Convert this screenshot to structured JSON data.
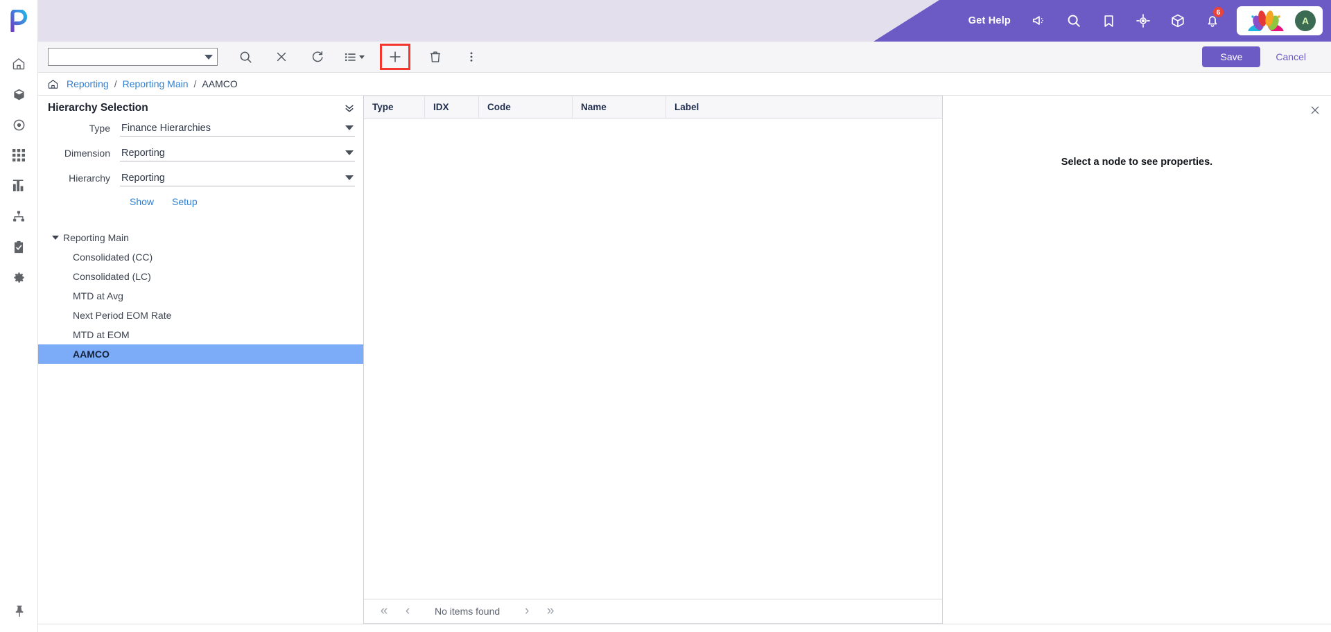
{
  "header": {
    "get_help": "Get Help",
    "icons": [
      {
        "name": "announcement-icon"
      },
      {
        "name": "search-icon"
      },
      {
        "name": "bookmark-icon"
      },
      {
        "name": "target-icon"
      },
      {
        "name": "cube-icon"
      },
      {
        "name": "bell-icon"
      }
    ],
    "notification_count": "6",
    "avatar_initial": "A",
    "brand_color": "#6c5bc4",
    "header_bg": "#e3dfec",
    "badge_color": "#e8443a"
  },
  "rail": {
    "items": [
      {
        "name": "home-icon",
        "label": "Home"
      },
      {
        "name": "cube-icon",
        "label": "Models"
      },
      {
        "name": "target-icon",
        "label": "Targets"
      },
      {
        "name": "grid-icon",
        "label": "Grids"
      },
      {
        "name": "chart-icon",
        "label": "Reports"
      },
      {
        "name": "hierarchy-icon",
        "label": "Hierarchies"
      },
      {
        "name": "clipboard-check-icon",
        "label": "Tasks"
      },
      {
        "name": "gear-icon",
        "label": "Settings"
      }
    ],
    "pin": {
      "name": "pin-icon",
      "label": "Pin"
    }
  },
  "toolbar": {
    "combo_value": "",
    "combo_placeholder": "",
    "buttons": [
      {
        "name": "search-icon",
        "label": "Search"
      },
      {
        "name": "clear-icon",
        "label": "Clear"
      },
      {
        "name": "refresh-icon",
        "label": "Refresh"
      },
      {
        "name": "list-view-icon",
        "label": "View"
      },
      {
        "name": "add-icon",
        "label": "Add"
      },
      {
        "name": "delete-icon",
        "label": "Delete"
      },
      {
        "name": "more-options-icon",
        "label": "More"
      }
    ],
    "save_label": "Save",
    "cancel_label": "Cancel",
    "highlight_color": "#f4362e"
  },
  "breadcrumb": {
    "home_icon": "home-icon",
    "items": [
      {
        "label": "Reporting",
        "link": true
      },
      {
        "label": "Reporting Main",
        "link": true
      },
      {
        "label": "AAMCO",
        "link": false
      }
    ],
    "separator": "/"
  },
  "hierarchy_panel": {
    "title": "Hierarchy Selection",
    "fields": [
      {
        "label": "Type",
        "value": "Finance Hierarchies"
      },
      {
        "label": "Dimension",
        "value": "Reporting"
      },
      {
        "label": "Hierarchy",
        "value": "Reporting"
      }
    ],
    "links": [
      {
        "label": "Show"
      },
      {
        "label": "Setup"
      }
    ],
    "tree": [
      {
        "label": "Reporting Main",
        "level": 0,
        "expanded": true,
        "selected": false
      },
      {
        "label": "Consolidated (CC)",
        "level": 1,
        "expanded": false,
        "selected": false
      },
      {
        "label": "Consolidated (LC)",
        "level": 1,
        "expanded": false,
        "selected": false
      },
      {
        "label": "MTD at Avg",
        "level": 1,
        "expanded": false,
        "selected": false
      },
      {
        "label": "Next Period EOM Rate",
        "level": 1,
        "expanded": false,
        "selected": false
      },
      {
        "label": "MTD at EOM",
        "level": 1,
        "expanded": false,
        "selected": false
      },
      {
        "label": "AAMCO",
        "level": 1,
        "expanded": false,
        "selected": true
      }
    ],
    "selected_color": "#7cabf7"
  },
  "grid": {
    "columns": [
      "Type",
      "IDX",
      "Code",
      "Name",
      "Label"
    ],
    "rows": [],
    "pagination": {
      "first": "«",
      "prev": "‹",
      "status": "No items found",
      "next": "›",
      "last": "»"
    }
  },
  "properties_panel": {
    "message": "Select a node to see properties.",
    "close_icon": "close-icon"
  }
}
